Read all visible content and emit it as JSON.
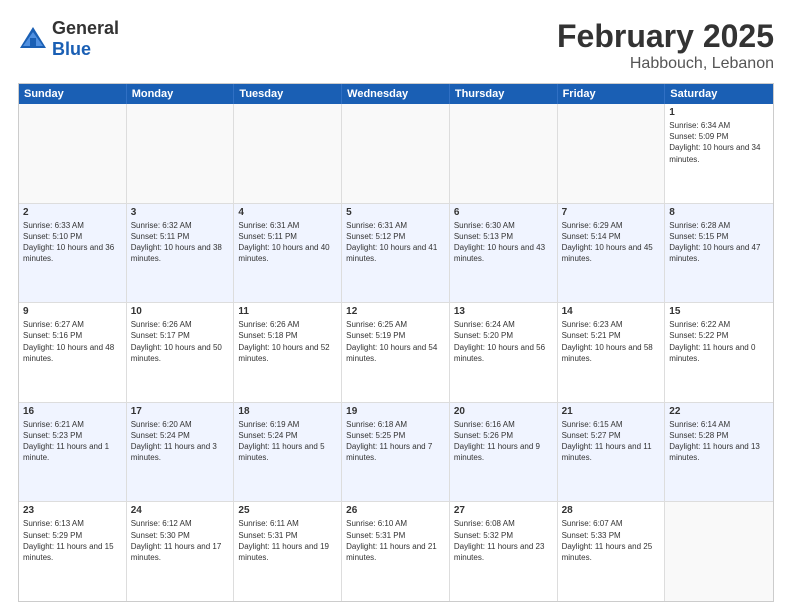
{
  "header": {
    "logo_general": "General",
    "logo_blue": "Blue",
    "month": "February 2025",
    "location": "Habbouch, Lebanon"
  },
  "calendar": {
    "days": [
      "Sunday",
      "Monday",
      "Tuesday",
      "Wednesday",
      "Thursday",
      "Friday",
      "Saturday"
    ],
    "rows": [
      [
        {
          "day": "",
          "text": ""
        },
        {
          "day": "",
          "text": ""
        },
        {
          "day": "",
          "text": ""
        },
        {
          "day": "",
          "text": ""
        },
        {
          "day": "",
          "text": ""
        },
        {
          "day": "",
          "text": ""
        },
        {
          "day": "1",
          "text": "Sunrise: 6:34 AM\nSunset: 5:09 PM\nDaylight: 10 hours and 34 minutes."
        }
      ],
      [
        {
          "day": "2",
          "text": "Sunrise: 6:33 AM\nSunset: 5:10 PM\nDaylight: 10 hours and 36 minutes."
        },
        {
          "day": "3",
          "text": "Sunrise: 6:32 AM\nSunset: 5:11 PM\nDaylight: 10 hours and 38 minutes."
        },
        {
          "day": "4",
          "text": "Sunrise: 6:31 AM\nSunset: 5:11 PM\nDaylight: 10 hours and 40 minutes."
        },
        {
          "day": "5",
          "text": "Sunrise: 6:31 AM\nSunset: 5:12 PM\nDaylight: 10 hours and 41 minutes."
        },
        {
          "day": "6",
          "text": "Sunrise: 6:30 AM\nSunset: 5:13 PM\nDaylight: 10 hours and 43 minutes."
        },
        {
          "day": "7",
          "text": "Sunrise: 6:29 AM\nSunset: 5:14 PM\nDaylight: 10 hours and 45 minutes."
        },
        {
          "day": "8",
          "text": "Sunrise: 6:28 AM\nSunset: 5:15 PM\nDaylight: 10 hours and 47 minutes."
        }
      ],
      [
        {
          "day": "9",
          "text": "Sunrise: 6:27 AM\nSunset: 5:16 PM\nDaylight: 10 hours and 48 minutes."
        },
        {
          "day": "10",
          "text": "Sunrise: 6:26 AM\nSunset: 5:17 PM\nDaylight: 10 hours and 50 minutes."
        },
        {
          "day": "11",
          "text": "Sunrise: 6:26 AM\nSunset: 5:18 PM\nDaylight: 10 hours and 52 minutes."
        },
        {
          "day": "12",
          "text": "Sunrise: 6:25 AM\nSunset: 5:19 PM\nDaylight: 10 hours and 54 minutes."
        },
        {
          "day": "13",
          "text": "Sunrise: 6:24 AM\nSunset: 5:20 PM\nDaylight: 10 hours and 56 minutes."
        },
        {
          "day": "14",
          "text": "Sunrise: 6:23 AM\nSunset: 5:21 PM\nDaylight: 10 hours and 58 minutes."
        },
        {
          "day": "15",
          "text": "Sunrise: 6:22 AM\nSunset: 5:22 PM\nDaylight: 11 hours and 0 minutes."
        }
      ],
      [
        {
          "day": "16",
          "text": "Sunrise: 6:21 AM\nSunset: 5:23 PM\nDaylight: 11 hours and 1 minute."
        },
        {
          "day": "17",
          "text": "Sunrise: 6:20 AM\nSunset: 5:24 PM\nDaylight: 11 hours and 3 minutes."
        },
        {
          "day": "18",
          "text": "Sunrise: 6:19 AM\nSunset: 5:24 PM\nDaylight: 11 hours and 5 minutes."
        },
        {
          "day": "19",
          "text": "Sunrise: 6:18 AM\nSunset: 5:25 PM\nDaylight: 11 hours and 7 minutes."
        },
        {
          "day": "20",
          "text": "Sunrise: 6:16 AM\nSunset: 5:26 PM\nDaylight: 11 hours and 9 minutes."
        },
        {
          "day": "21",
          "text": "Sunrise: 6:15 AM\nSunset: 5:27 PM\nDaylight: 11 hours and 11 minutes."
        },
        {
          "day": "22",
          "text": "Sunrise: 6:14 AM\nSunset: 5:28 PM\nDaylight: 11 hours and 13 minutes."
        }
      ],
      [
        {
          "day": "23",
          "text": "Sunrise: 6:13 AM\nSunset: 5:29 PM\nDaylight: 11 hours and 15 minutes."
        },
        {
          "day": "24",
          "text": "Sunrise: 6:12 AM\nSunset: 5:30 PM\nDaylight: 11 hours and 17 minutes."
        },
        {
          "day": "25",
          "text": "Sunrise: 6:11 AM\nSunset: 5:31 PM\nDaylight: 11 hours and 19 minutes."
        },
        {
          "day": "26",
          "text": "Sunrise: 6:10 AM\nSunset: 5:31 PM\nDaylight: 11 hours and 21 minutes."
        },
        {
          "day": "27",
          "text": "Sunrise: 6:08 AM\nSunset: 5:32 PM\nDaylight: 11 hours and 23 minutes."
        },
        {
          "day": "28",
          "text": "Sunrise: 6:07 AM\nSunset: 5:33 PM\nDaylight: 11 hours and 25 minutes."
        },
        {
          "day": "",
          "text": ""
        }
      ]
    ]
  }
}
